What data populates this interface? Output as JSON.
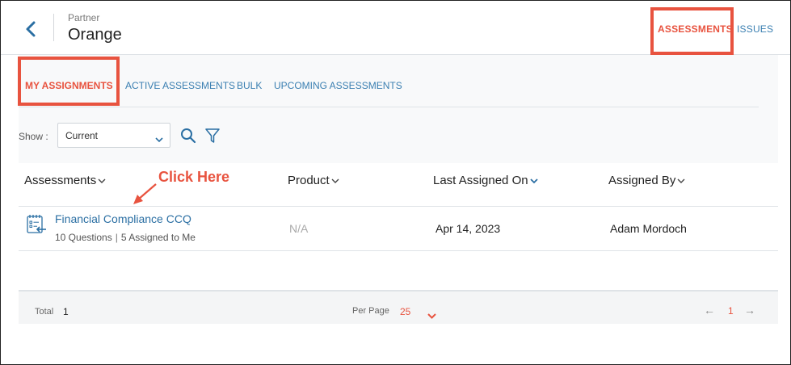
{
  "header": {
    "back_icon": "chevron-left-icon",
    "partner_label": "Partner",
    "partner_name": "Orange",
    "nav": {
      "assessments": "ASSESSMENTS",
      "issues": "ISSUES"
    }
  },
  "subtabs": {
    "my_assignments": "MY ASSIGNMENTS",
    "active_assessments": "ACTIVE ASSESSMENTS",
    "bulk": "BULK",
    "upcoming_assessments": "UPCOMING ASSESSMENTS"
  },
  "toolbar": {
    "show_label": "Show :",
    "show_value": "Current",
    "search_icon": "search-icon",
    "filter_icon": "filter-icon"
  },
  "table": {
    "columns": [
      "Assessments",
      "Product",
      "Last Assigned On",
      "Assigned By"
    ],
    "rows": [
      {
        "icon": "assessment-checklist-icon",
        "title": "Financial Compliance CCQ",
        "questions": "10 Questions",
        "assigned": "5 Assigned to Me",
        "product": "N/A",
        "last_assigned": "Apr 14, 2023",
        "assigned_by": "Adam Mordoch"
      }
    ]
  },
  "footer": {
    "total_label": "Total",
    "total_value": "1",
    "per_page_label": "Per Page",
    "per_page_value": "25",
    "prev": "←",
    "page": "1",
    "next": "→"
  },
  "annotation": {
    "callout": "Click Here"
  },
  "colors": {
    "accent": "#e8533f",
    "link": "#2b6fa3",
    "nav": "#3a7fb1"
  }
}
